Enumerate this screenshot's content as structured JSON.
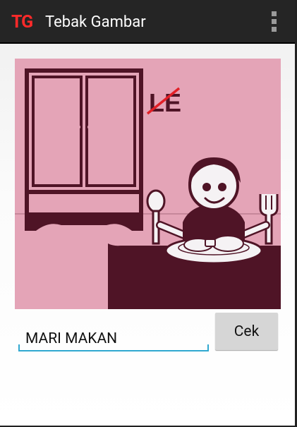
{
  "app": {
    "logo": "TG",
    "title": "Tebak Gambar"
  },
  "puzzle": {
    "hint_letters": "LE",
    "hint_struck_letter": "L"
  },
  "answer": {
    "value": "MARI MAKAN"
  },
  "actions": {
    "check_label": "Cek"
  },
  "colors": {
    "accent": "#30a8d0",
    "logo": "#ff2a2a",
    "image_background": "#e4a4b7",
    "image_ink": "#4f1426"
  }
}
